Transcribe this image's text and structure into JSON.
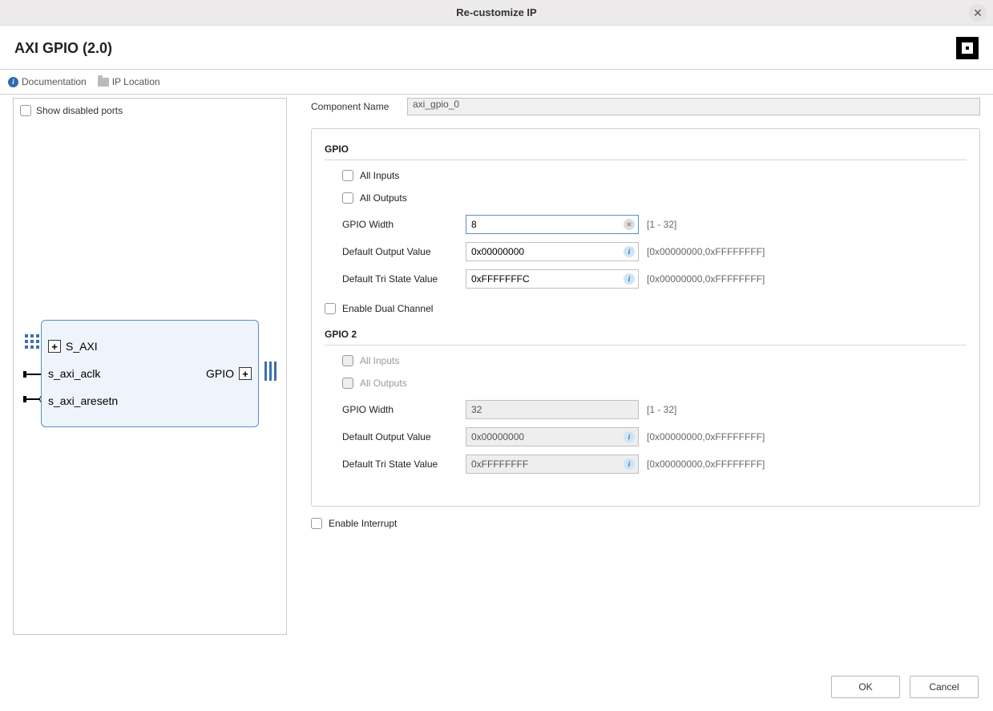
{
  "window": {
    "title": "Re-customize IP"
  },
  "ip": {
    "title": "AXI GPIO (2.0)"
  },
  "links": {
    "documentation": "Documentation",
    "ip_location": "IP Location"
  },
  "preview": {
    "show_disabled_label": "Show disabled ports",
    "ports": {
      "s_axi": "S_AXI",
      "aclk": "s_axi_aclk",
      "aresetn": "s_axi_aresetn",
      "gpio": "GPIO"
    }
  },
  "component_name": {
    "label": "Component Name",
    "value": "axi_gpio_0"
  },
  "gpio": {
    "header": "GPIO",
    "all_inputs": "All Inputs",
    "all_outputs": "All Outputs",
    "width_label": "GPIO Width",
    "width_value": "8",
    "width_range": "[1 - 32]",
    "default_output_label": "Default Output Value",
    "default_output_value": "0x00000000",
    "default_output_range": "[0x00000000,0xFFFFFFFF]",
    "tristate_label": "Default Tri State Value",
    "tristate_value": "0xFFFFFFFC",
    "tristate_range": "[0x00000000,0xFFFFFFFF]",
    "enable_dual": "Enable Dual Channel"
  },
  "gpio2": {
    "header": "GPIO 2",
    "all_inputs": "All Inputs",
    "all_outputs": "All Outputs",
    "width_label": "GPIO Width",
    "width_value": "32",
    "width_range": "[1 - 32]",
    "default_output_label": "Default Output Value",
    "default_output_value": "0x00000000",
    "default_output_range": "[0x00000000,0xFFFFFFFF]",
    "tristate_label": "Default Tri State Value",
    "tristate_value": "0xFFFFFFFF",
    "tristate_range": "[0x00000000,0xFFFFFFFF]"
  },
  "interrupt": {
    "label": "Enable Interrupt"
  },
  "buttons": {
    "ok": "OK",
    "cancel": "Cancel"
  }
}
